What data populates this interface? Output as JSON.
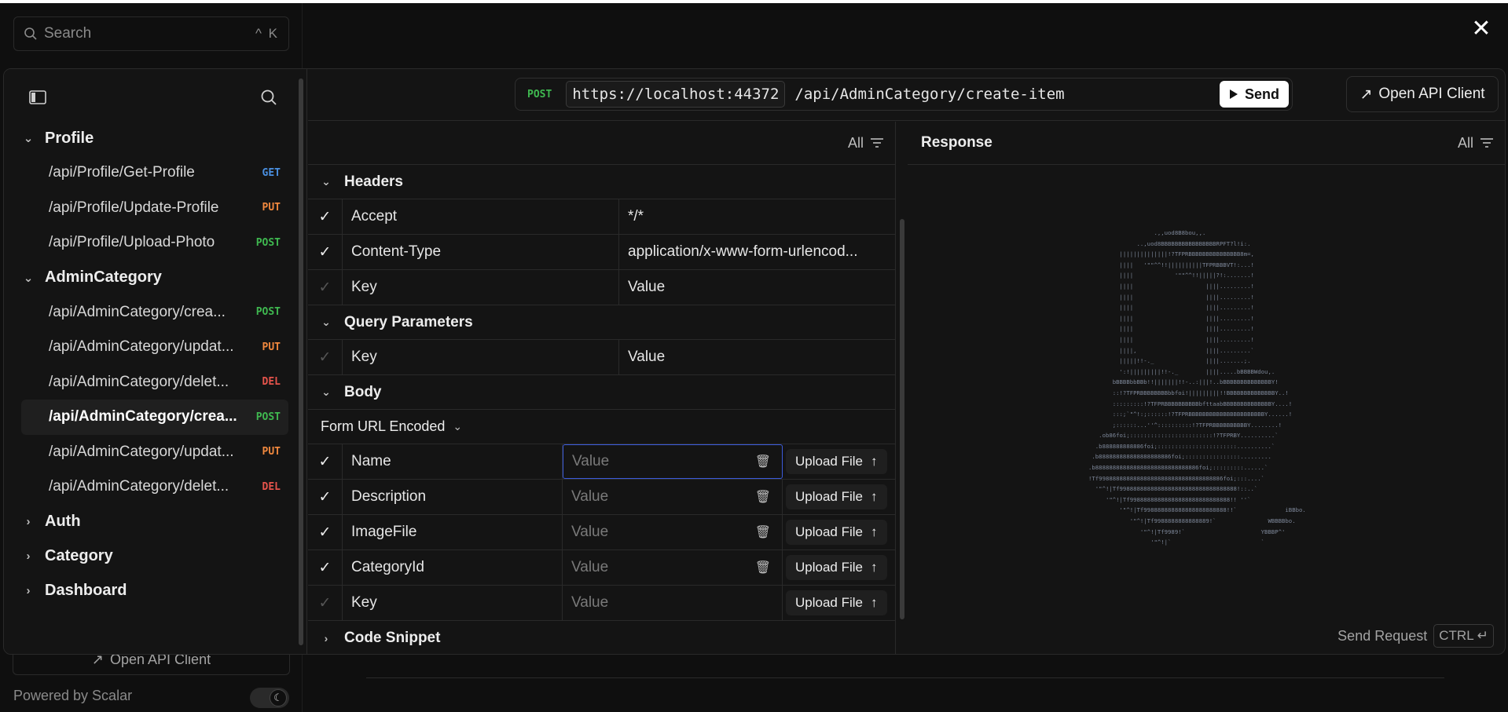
{
  "background": {
    "search_placeholder": "Search",
    "search_shortcut": "^ K",
    "open_api_client": "Open API Client",
    "powered_by": "Powered by Scalar"
  },
  "sidebar": {
    "groups": [
      {
        "label": "Profile",
        "expanded": true,
        "items": [
          {
            "path": "/api/Profile/Get-Profile",
            "method": "GET",
            "color": "#4a90e2"
          },
          {
            "path": "/api/Profile/Update-Profile",
            "method": "PUT",
            "color": "#f0883e"
          },
          {
            "path": "/api/Profile/Upload-Photo",
            "method": "POST",
            "color": "#3fb950"
          }
        ]
      },
      {
        "label": "AdminCategory",
        "expanded": true,
        "items": [
          {
            "path": "/api/AdminCategory/crea...",
            "method": "POST",
            "color": "#3fb950"
          },
          {
            "path": "/api/AdminCategory/updat...",
            "method": "PUT",
            "color": "#f0883e"
          },
          {
            "path": "/api/AdminCategory/delet...",
            "method": "DEL",
            "color": "#e5534b"
          },
          {
            "path": "/api/AdminCategory/crea...",
            "method": "POST",
            "color": "#3fb950",
            "active": true
          },
          {
            "path": "/api/AdminCategory/updat...",
            "method": "PUT",
            "color": "#f0883e"
          },
          {
            "path": "/api/AdminCategory/delet...",
            "method": "DEL",
            "color": "#e5534b"
          }
        ]
      },
      {
        "label": "Auth",
        "expanded": false
      },
      {
        "label": "Category",
        "expanded": false
      },
      {
        "label": "Dashboard",
        "expanded": false
      }
    ]
  },
  "address": {
    "method": "POST",
    "host": "https://localhost:44372",
    "path": "/api/AdminCategory/create-item",
    "send_label": "Send"
  },
  "open_api_client": "Open API Client",
  "request": {
    "filter_label": "All",
    "headers_title": "Headers",
    "headers": [
      {
        "key": "Accept",
        "value": "*/*",
        "checked": true
      },
      {
        "key": "Content-Type",
        "value": "application/x-www-form-urlencod...",
        "checked": true
      }
    ],
    "key_placeholder": "Key",
    "value_placeholder": "Value",
    "query_title": "Query Parameters",
    "body_title": "Body",
    "body_type": "Form URL Encoded",
    "form_fields": [
      "Name",
      "Description",
      "ImageFile",
      "CategoryId"
    ],
    "upload_label": "Upload File",
    "code_snippet_title": "Code Snippet"
  },
  "response": {
    "title": "Response",
    "filter_label": "All",
    "send_request_label": "Send Request",
    "shortcut": "CTRL ↵"
  }
}
